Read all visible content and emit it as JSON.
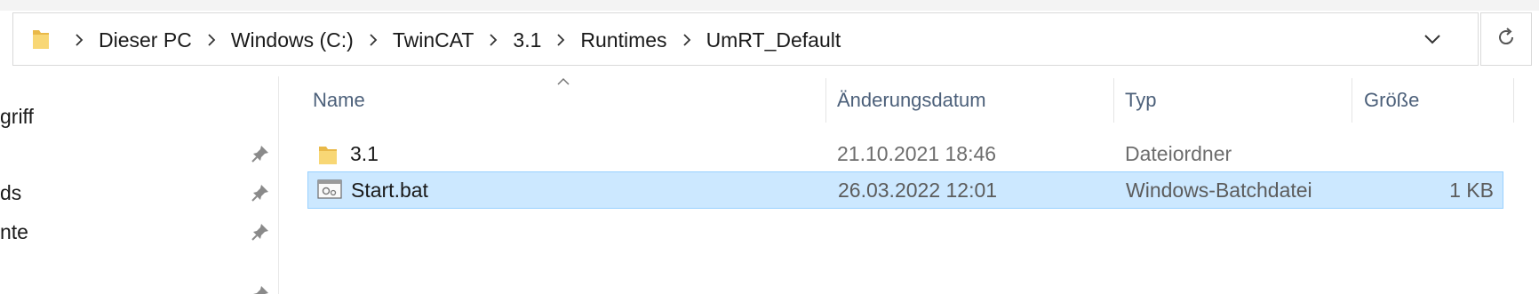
{
  "address": {
    "folder_icon": "folder-icon",
    "breadcrumbs": [
      "Dieser PC",
      "Windows (C:)",
      "TwinCAT",
      "3.1",
      "Runtimes",
      "UmRT_Default"
    ],
    "dropdown_icon": "chevron-down-icon",
    "refresh_icon": "refresh-icon"
  },
  "nav_pane": {
    "items": [
      {
        "label": "griff",
        "pinned": false
      },
      {
        "label": "",
        "pinned": true
      },
      {
        "label": "ds",
        "pinned": true
      },
      {
        "label": "nte",
        "pinned": true
      }
    ]
  },
  "columns": {
    "name": "Name",
    "date": "Änderungsdatum",
    "type": "Typ",
    "size": "Größe"
  },
  "files": [
    {
      "name": "3.1",
      "date": "21.10.2021 18:46",
      "type": "Dateiordner",
      "size": "",
      "icon": "folder-icon",
      "selected": false
    },
    {
      "name": "Start.bat",
      "date": "26.03.2022 12:01",
      "type": "Windows-Batchdatei",
      "size": "1 KB",
      "icon": "batch-file-icon",
      "selected": true
    }
  ],
  "colors": {
    "selection_bg": "#cce8ff",
    "selection_border": "#99d1ff",
    "header_text": "#4c607a",
    "folder_yellow": "#f8d775"
  }
}
